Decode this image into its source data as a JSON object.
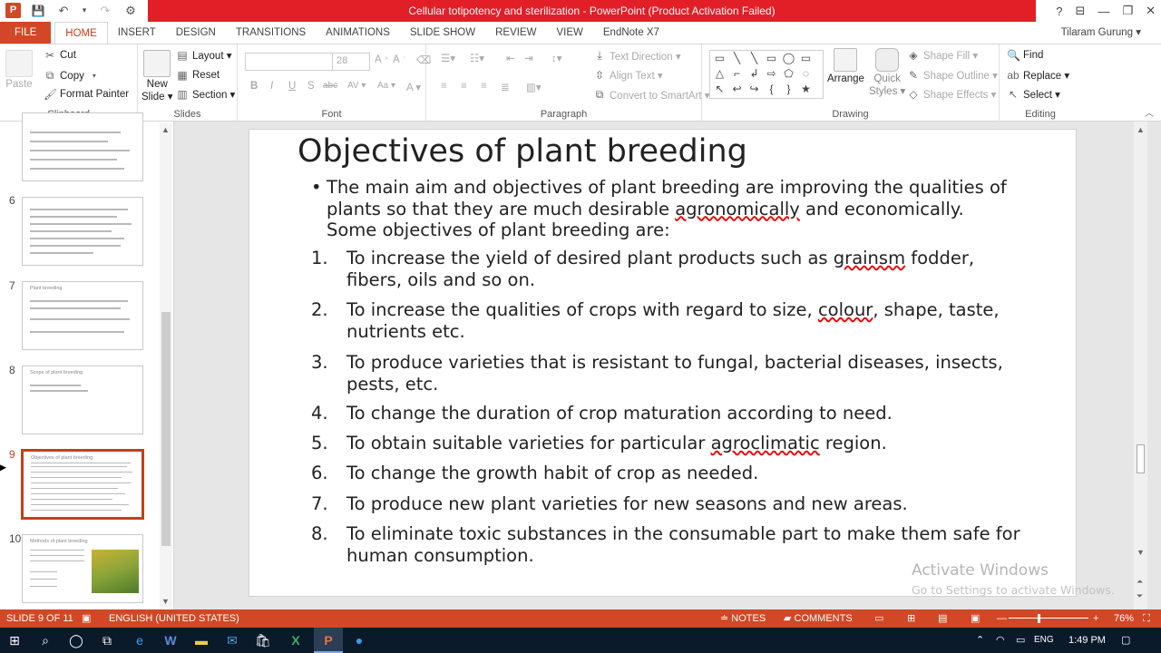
{
  "window": {
    "title": "Cellular totipotency and sterilization -  PowerPoint (Product Activation Failed)",
    "help": "?",
    "ribbon_display": "⊟",
    "minimize": "—",
    "restore": "❐",
    "close": "✕"
  },
  "qat": {
    "logo": "P",
    "save": "💾",
    "undo": "↶",
    "undo_dd": "▾",
    "redo": "↷",
    "customize": "⚙"
  },
  "tabs": [
    "FILE",
    "HOME",
    "INSERT",
    "DESIGN",
    "TRANSITIONS",
    "ANIMATIONS",
    "SLIDE SHOW",
    "REVIEW",
    "VIEW",
    "EndNote X7"
  ],
  "active_tab": "HOME",
  "user": "Tilaram Gurung ▾",
  "ribbon": {
    "clipboard": {
      "label": "Clipboard",
      "paste": "Paste",
      "cut": "Cut",
      "copy": "Copy",
      "format_painter": "Format Painter"
    },
    "slides": {
      "label": "Slides",
      "new_slide_line1": "New",
      "new_slide_line2": "Slide ▾",
      "layout": "Layout ▾",
      "reset": "Reset",
      "section": "Section ▾"
    },
    "font": {
      "label": "Font",
      "font_name": "",
      "font_size": "28",
      "bold": "B",
      "italic": "I",
      "underline": "U",
      "strike": "S",
      "shadow": "abc",
      "spacing": "AV ▾",
      "case": "Aa ▾",
      "color": "A ▾"
    },
    "paragraph": {
      "label": "Paragraph",
      "text_direction": "Text Direction ▾",
      "align_text": "Align Text ▾",
      "convert_smartart": "Convert to SmartArt ▾"
    },
    "drawing": {
      "label": "Drawing",
      "arrange": "Arrange",
      "quick_styles_line1": "Quick",
      "quick_styles_line2": "Styles ▾",
      "shape_fill": "Shape Fill ▾",
      "shape_outline": "Shape Outline ▾",
      "shape_effects": "Shape Effects ▾",
      "shapes": [
        "▭",
        "╲",
        "╲",
        "▭",
        "◯",
        "▭",
        "△",
        "⌐",
        "↲",
        "⇨",
        "⬠",
        "◌",
        "↖",
        "↩",
        "↪",
        "{",
        "}",
        "★"
      ]
    },
    "editing": {
      "label": "Editing",
      "find": "Find",
      "replace": "Replace ▾",
      "select": "Select ▾"
    }
  },
  "thumbnails": [
    {
      "num": "",
      "title": ""
    },
    {
      "num": "6",
      "title": ""
    },
    {
      "num": "7",
      "title": "Plant breeding"
    },
    {
      "num": "8",
      "title": "Scope of plant breeding"
    },
    {
      "num": "9",
      "title": "Objectives of plant breeding"
    },
    {
      "num": "10",
      "title": "Methods of plant breeding"
    }
  ],
  "slide": {
    "title": "Objectives of plant breeding",
    "bullet": "•",
    "intro_pre": "The main aim and objectives of plant breeding are improving the qualities of plants so that they are much desirable ",
    "intro_u": "agronomically",
    "intro_post": " and economically. Some objectives of plant breeding are:",
    "items": [
      {
        "num": "1.",
        "pre": "To increase the yield of desired plant products such as ",
        "u": "grainsm",
        "post": " fodder, fibers, oils and so on."
      },
      {
        "num": "2.",
        "pre": "To increase the qualities of crops with regard to size, ",
        "u": "colour",
        "post": ", shape, taste, nutrients etc."
      },
      {
        "num": "3.",
        "pre": "To produce varieties that is resistant to fungal, bacterial diseases, insects, pests, etc.",
        "u": "",
        "post": ""
      },
      {
        "num": "4.",
        "pre": "To change the duration of crop maturation according to need.",
        "u": "",
        "post": ""
      },
      {
        "num": "5.",
        "pre": "To obtain suitable varieties for particular ",
        "u": "agroclimatic",
        "post": " region."
      },
      {
        "num": "6.",
        "pre": "To change the growth habit of crop as needed.",
        "u": "",
        "post": ""
      },
      {
        "num": "7.",
        "pre": "To produce new plant varieties for new seasons and new areas.",
        "u": "",
        "post": ""
      },
      {
        "num": "8.",
        "pre": "To eliminate toxic substances in the consumable part to make them safe for human consumption.",
        "u": "",
        "post": ""
      }
    ]
  },
  "watermark": {
    "line1": "Activate Windows",
    "line2": "Go to Settings to activate Windows."
  },
  "status": {
    "slide": "SLIDE 9 OF 11",
    "language": "ENGLISH (UNITED STATES)",
    "notes": "NOTES",
    "comments": "COMMENTS",
    "zoom": "76%",
    "zoom_level": 0.76
  },
  "taskbar": {
    "lang": "ENG",
    "time": "1:49 PM"
  }
}
